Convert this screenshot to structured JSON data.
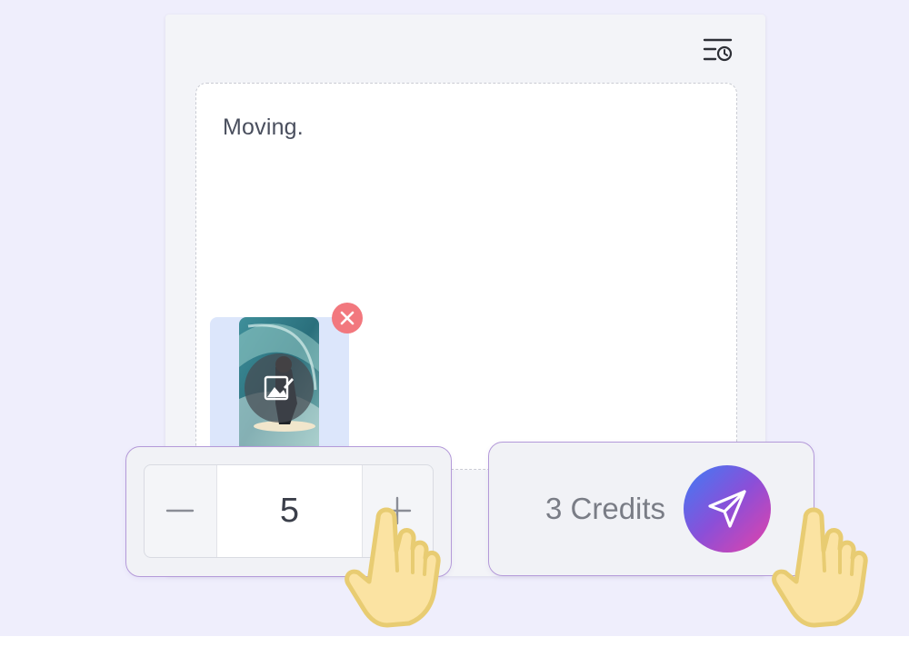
{
  "panel": {
    "history_icon": "history-clock-icon"
  },
  "prompt": {
    "text": "Moving."
  },
  "attachment": {
    "remove_icon": "close-icon",
    "edit_icon": "image-edit-icon"
  },
  "quantity": {
    "value": "5",
    "decrement_icon": "minus-icon",
    "increment_icon": "plus-icon"
  },
  "submit": {
    "credits_label": "3 Credits",
    "send_icon": "paper-plane-icon",
    "gradient": [
      "#3e7cf5",
      "#8b4fd8",
      "#e542a8"
    ]
  },
  "colors": {
    "background": "#efeefc",
    "card_border": "#b49ad9",
    "remove_badge": "#f2787e",
    "hand_fill": "#fbe3a2",
    "hand_stroke": "#e8cc72"
  }
}
